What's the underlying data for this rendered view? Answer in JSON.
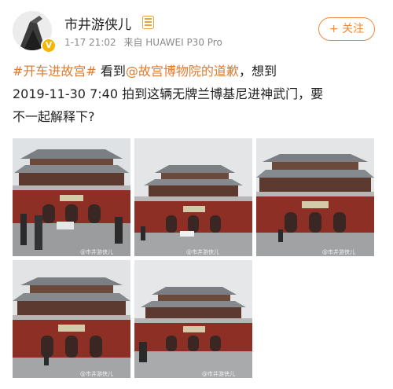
{
  "user": {
    "name": "市井游侠儿",
    "verified_badge": "V",
    "member_icon": "weibo-member-icon"
  },
  "meta": {
    "time": "1-17 21:02",
    "source": "来自 HUAWEI P30 Pro"
  },
  "follow_button": {
    "label": "+ 关注"
  },
  "post": {
    "hashtag": "#开车进故宫#",
    "t1": " 看到",
    "mention": "@故宫博物院的道歉",
    "t2": "，想到",
    "line2": "2019-11-30 7:40 拍到这辆无牌兰博基尼进神武门，要",
    "line3": "不一起解释下?"
  },
  "photos": {
    "count": 5,
    "watermark": "@市井游侠儿",
    "gate_sign": "故宫博物院"
  },
  "colors": {
    "accent": "#e07a2e",
    "wall_red": "#8e2f26",
    "roof_gray": "#7b7f83",
    "sky": "#e6e8ea"
  }
}
